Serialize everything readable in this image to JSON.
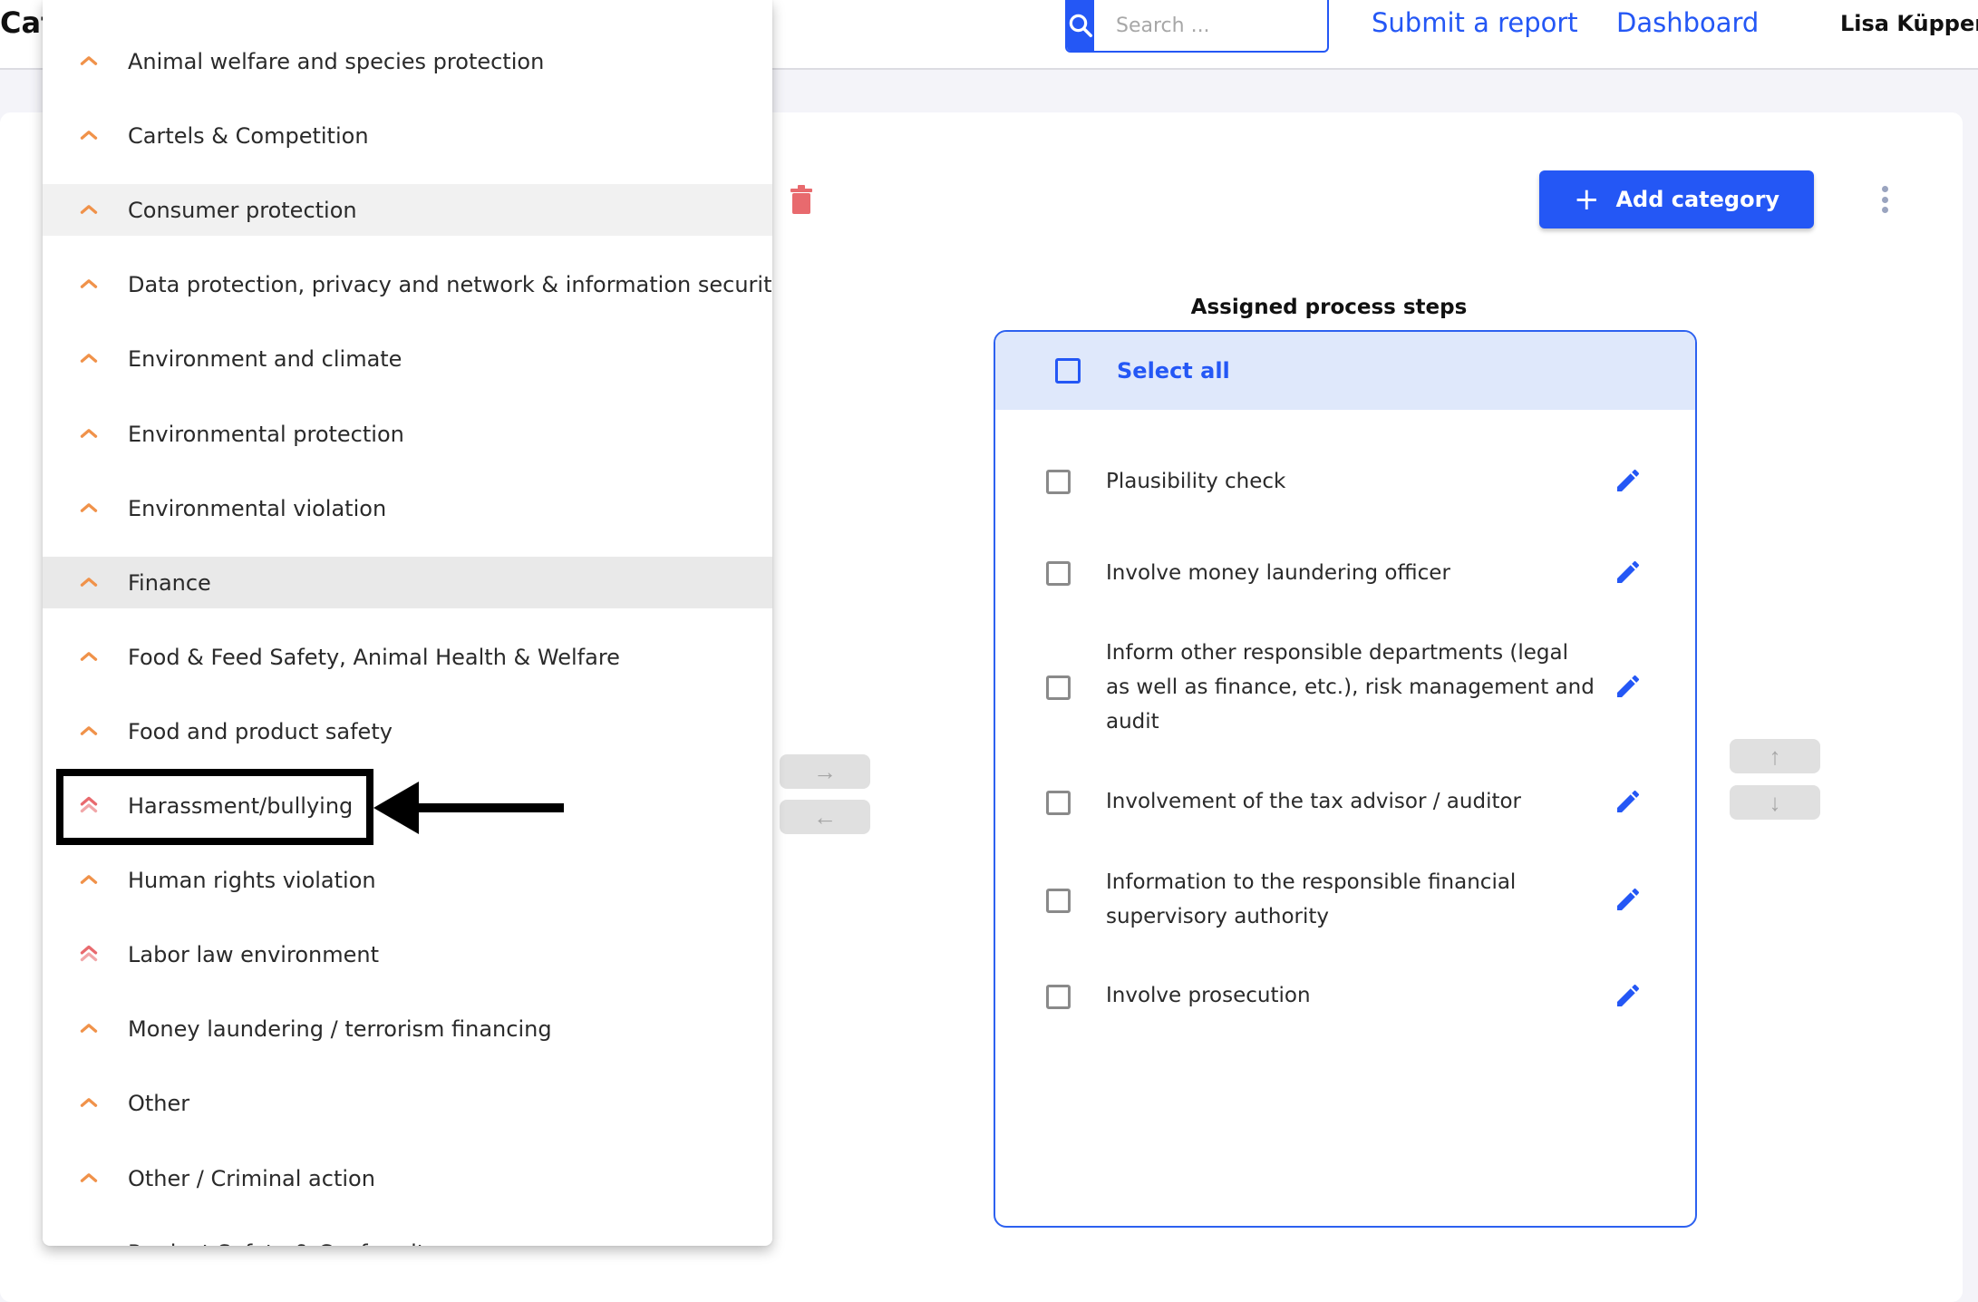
{
  "header": {
    "page_title": "Cat",
    "search_placeholder": "Search ...",
    "search_icon": "search-icon",
    "nav_links": [
      "Submit a report",
      "Dashboard"
    ],
    "user_name": "Lisa Küppers"
  },
  "toolbar": {
    "add_category_label": "Add category",
    "add_icon": "plus-icon",
    "delete_icon": "trash-icon",
    "more_icon": "kebab-menu-icon"
  },
  "category_dropdown": {
    "items": [
      {
        "label": "Animal welfare and species protection",
        "priority": "medium"
      },
      {
        "label": "Cartels & Competition",
        "priority": "medium"
      },
      {
        "label": "Consumer protection",
        "priority": "medium",
        "state": "hover"
      },
      {
        "label": "Data protection, privacy and network & information security",
        "priority": "medium"
      },
      {
        "label": "Environment and climate",
        "priority": "medium"
      },
      {
        "label": "Environmental protection",
        "priority": "medium"
      },
      {
        "label": "Environmental violation",
        "priority": "medium"
      },
      {
        "label": "Finance",
        "priority": "medium",
        "state": "selected"
      },
      {
        "label": "Food & Feed Safety, Animal Health & Welfare",
        "priority": "medium"
      },
      {
        "label": "Food and product safety",
        "priority": "medium"
      },
      {
        "label": "Harassment/bullying",
        "priority": "high"
      },
      {
        "label": "Human rights violation",
        "priority": "medium"
      },
      {
        "label": "Labor law environment",
        "priority": "high"
      },
      {
        "label": "Money laundering / terrorism financing",
        "priority": "medium"
      },
      {
        "label": "Other",
        "priority": "medium"
      },
      {
        "label": "Other / Criminal action",
        "priority": "medium"
      },
      {
        "label": "Product Safety & Conformity",
        "priority": "medium",
        "state": "clipped"
      }
    ],
    "colors": {
      "medium": "#f0924a",
      "high": "#e86a6e"
    }
  },
  "transfer_buttons": {
    "move_right": "→",
    "move_left": "←"
  },
  "order_buttons": {
    "move_up": "↑",
    "move_down": "↓"
  },
  "assigned_steps": {
    "title": "Assigned process steps",
    "select_all_label": "Select all",
    "select_all_checked": false,
    "steps": [
      {
        "label": "Plausibility check",
        "checked": false
      },
      {
        "label": "Involve money laundering officer",
        "checked": false
      },
      {
        "label": "Inform other responsible departments (legal as well as finance, etc.), risk management and audit",
        "checked": false
      },
      {
        "label": "Involvement of the tax advisor / auditor",
        "checked": false
      },
      {
        "label": "Information to the responsible financial supervisory authority",
        "checked": false
      },
      {
        "label": "Involve prosecution",
        "checked": false
      }
    ]
  },
  "annotation": {
    "target": "Harassment/bullying",
    "type": "highlight-box-with-arrow"
  },
  "colors": {
    "accent": "#2457f5",
    "danger": "#e86a6e",
    "select_all_bg": "#dfe8fb"
  }
}
